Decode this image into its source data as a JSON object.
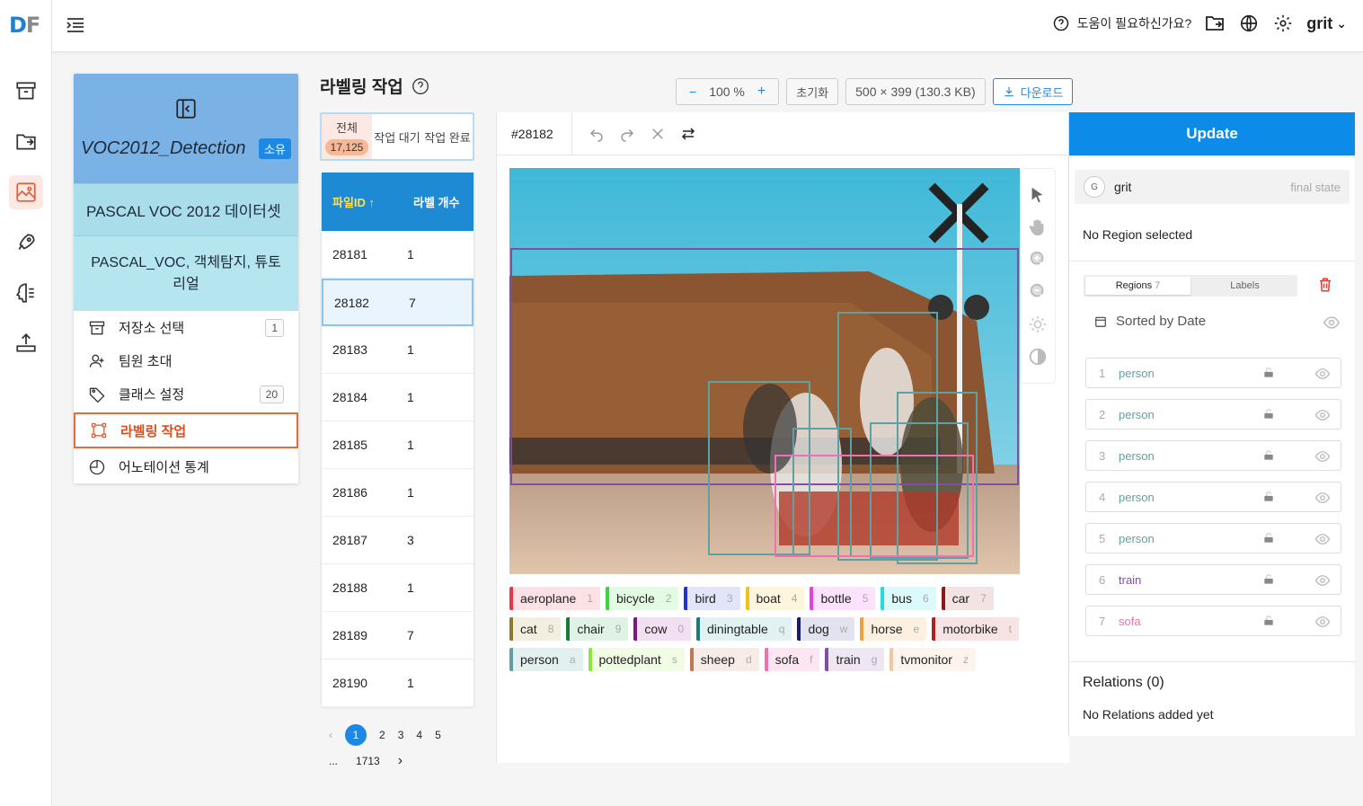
{
  "app": {
    "logo_main": "D",
    "logo_accent": "F"
  },
  "topbar": {
    "help_label": "도움이 필요하신가요?",
    "user_name": "grit"
  },
  "project": {
    "title": "VOC2012_Detection",
    "badge": "소유",
    "dataset": "PASCAL VOC 2012 데이터셋",
    "description": "PASCAL_VOC, 객체탐지, 튜토리얼",
    "menu": [
      {
        "label": "저장소 선택",
        "count": "1"
      },
      {
        "label": "팀원 초대",
        "count": ""
      },
      {
        "label": "클래스 설정",
        "count": "20"
      },
      {
        "label": "라벨링 작업",
        "count": ""
      },
      {
        "label": "어노테이션 통계",
        "count": ""
      }
    ]
  },
  "labeling": {
    "title": "라벨링 작업",
    "tabs": [
      {
        "label": "전체",
        "count": "17,125"
      },
      {
        "label": "작업 대기"
      },
      {
        "label": "작업 완료"
      }
    ],
    "table": {
      "headers": [
        "파일ID ↑",
        "라벨 개수"
      ],
      "rows": [
        [
          "28181",
          "1"
        ],
        [
          "28182",
          "7"
        ],
        [
          "28183",
          "1"
        ],
        [
          "28184",
          "1"
        ],
        [
          "28185",
          "1"
        ],
        [
          "28186",
          "1"
        ],
        [
          "28187",
          "3"
        ],
        [
          "28188",
          "1"
        ],
        [
          "28189",
          "7"
        ],
        [
          "28190",
          "1"
        ]
      ]
    },
    "pager": {
      "pages": [
        "1",
        "2",
        "3",
        "4",
        "5"
      ],
      "ellipsis": "...",
      "last": "1713"
    }
  },
  "toolbar": {
    "zoom_minus": "−",
    "zoom": "100 %",
    "zoom_plus": "+",
    "reset": "초기화",
    "image_info": "500 × 399 (130.3 KB)",
    "download": "다운로드"
  },
  "editor": {
    "file_id": "#28182"
  },
  "labels": [
    {
      "name": "aeroplane",
      "key": "1",
      "color": "#e8364a",
      "bg": "#fde2e5"
    },
    {
      "name": "bicycle",
      "key": "2",
      "color": "#3fd43f",
      "bg": "#e3fbe3"
    },
    {
      "name": "bird",
      "key": "3",
      "color": "#2233cc",
      "bg": "#e2e5fa"
    },
    {
      "name": "boat",
      "key": "4",
      "color": "#f0c020",
      "bg": "#fdf6dc"
    },
    {
      "name": "bottle",
      "key": "5",
      "color": "#e83ce8",
      "bg": "#fce2fc"
    },
    {
      "name": "bus",
      "key": "6",
      "color": "#22dddd",
      "bg": "#ddfafa"
    },
    {
      "name": "car",
      "key": "7",
      "color": "#8a1a1a",
      "bg": "#f3e3e3"
    },
    {
      "name": "cat",
      "key": "8",
      "color": "#8a7a2a",
      "bg": "#f2efe0"
    },
    {
      "name": "chair",
      "key": "9",
      "color": "#1a7a3a",
      "bg": "#e0f2e6"
    },
    {
      "name": "cow",
      "key": "0",
      "color": "#7a1a7a",
      "bg": "#f2e0f2"
    },
    {
      "name": "diningtable",
      "key": "q",
      "color": "#1a7a7a",
      "bg": "#e0f2f2"
    },
    {
      "name": "dog",
      "key": "w",
      "color": "#1a1a6a",
      "bg": "#e2e2f0"
    },
    {
      "name": "horse",
      "key": "e",
      "color": "#f0a040",
      "bg": "#fdf0e0"
    },
    {
      "name": "motorbike",
      "key": "t",
      "color": "#aa2222",
      "bg": "#f7e3e3"
    },
    {
      "name": "person",
      "key": "a",
      "color": "#5fa0a0",
      "bg": "#e3f0f0"
    },
    {
      "name": "pottedplant",
      "key": "s",
      "color": "#88e840",
      "bg": "#f0fce3"
    },
    {
      "name": "sheep",
      "key": "d",
      "color": "#c07850",
      "bg": "#f7ede6"
    },
    {
      "name": "sofa",
      "key": "f",
      "color": "#f070b0",
      "bg": "#fde6f2"
    },
    {
      "name": "train",
      "key": "g",
      "color": "#8050a0",
      "bg": "#efe6f4"
    },
    {
      "name": "tvmonitor",
      "key": "z",
      "color": "#f0c8a0",
      "bg": "#fdf5ec"
    }
  ],
  "right_panel": {
    "update": "Update",
    "user_initial": "G",
    "user_name": "grit",
    "user_state": "final state",
    "no_region": "No Region selected",
    "tabs": {
      "regions": "Regions",
      "regions_count": "7",
      "labels": "Labels"
    },
    "sorted": "Sorted by Date",
    "regions": [
      {
        "n": "1",
        "label": "person",
        "color": "#5fa0a0"
      },
      {
        "n": "2",
        "label": "person",
        "color": "#5fa0a0"
      },
      {
        "n": "3",
        "label": "person",
        "color": "#5fa0a0"
      },
      {
        "n": "4",
        "label": "person",
        "color": "#5fa0a0"
      },
      {
        "n": "5",
        "label": "person",
        "color": "#5fa0a0"
      },
      {
        "n": "6",
        "label": "train",
        "color": "#8050a0"
      },
      {
        "n": "7",
        "label": "sofa",
        "color": "#f070b0"
      }
    ],
    "relations_title": "Relations (0)",
    "relations_empty": "No Relations added yet"
  }
}
